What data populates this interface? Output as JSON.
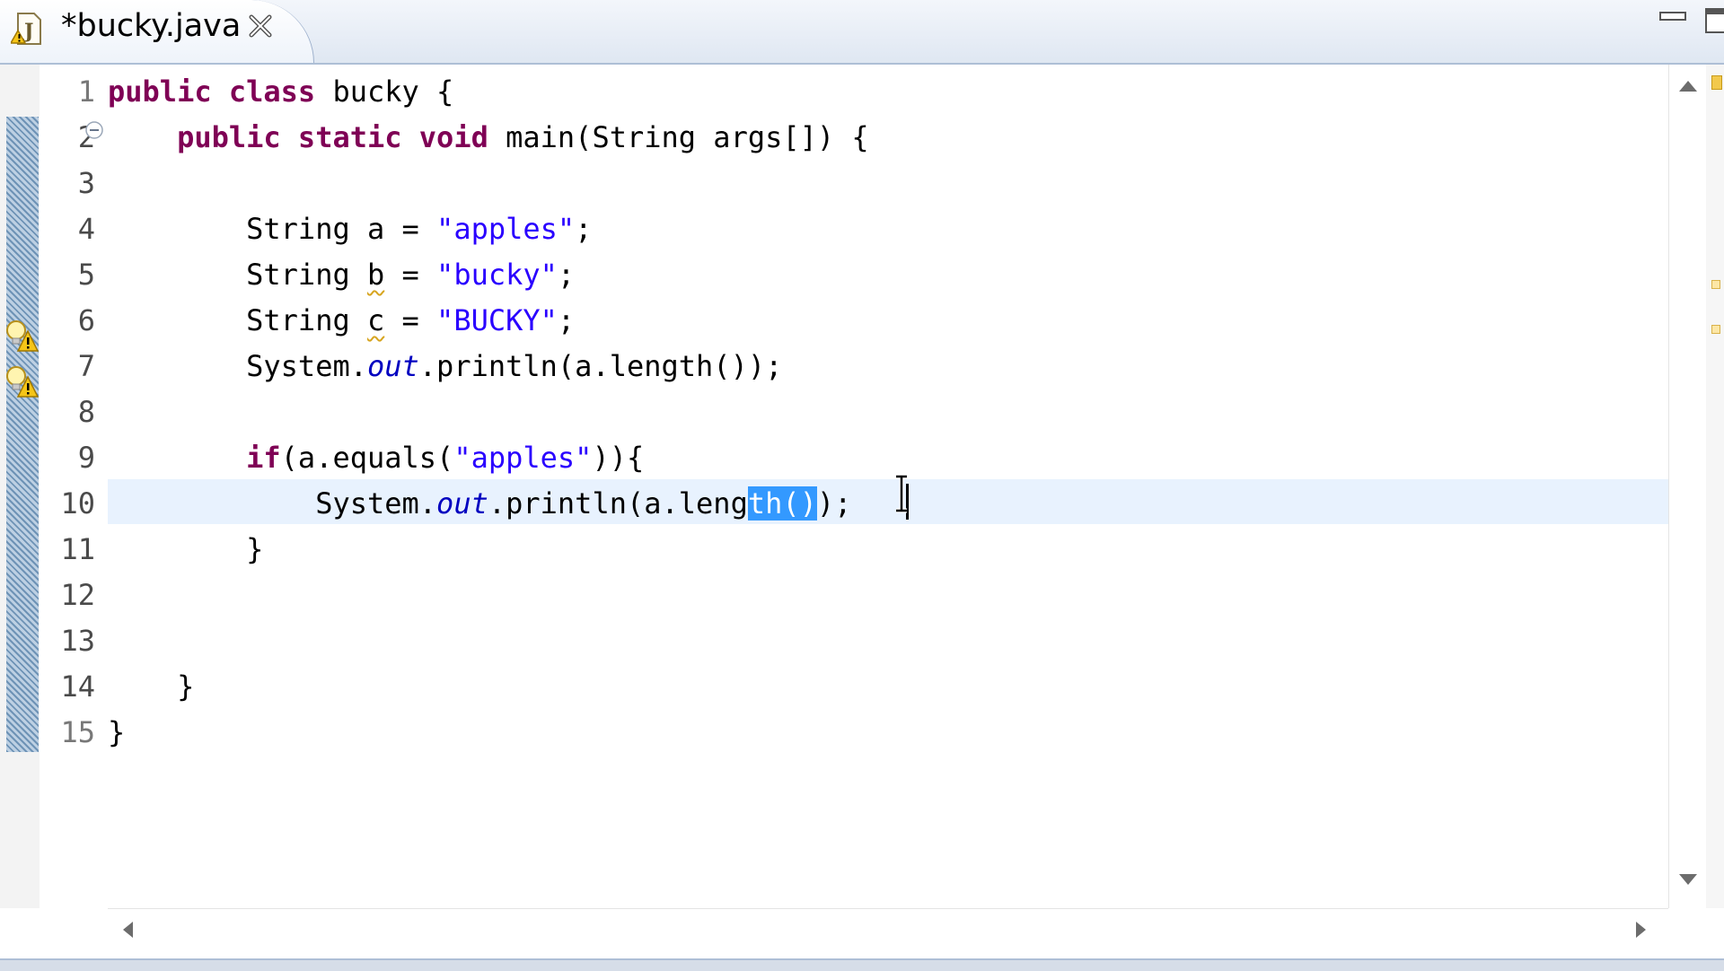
{
  "tab": {
    "title": "*bucky.java",
    "file_icon": "java-file-warning-icon",
    "close_icon": "close-icon"
  },
  "window_controls": {
    "minimize_icon": "minimize-icon",
    "maximize_icon": "maximize-icon"
  },
  "editor": {
    "line_numbers": [
      "1",
      "2",
      "3",
      "4",
      "5",
      "6",
      "7",
      "8",
      "9",
      "10",
      "11",
      "12",
      "13",
      "14",
      "15"
    ],
    "changed_lines": [
      2,
      3,
      4,
      5,
      6,
      7,
      8,
      9,
      10,
      11,
      12,
      13,
      14
    ],
    "warning_lines": [
      5,
      6
    ],
    "fold_line": 2,
    "current_line": 10,
    "lines": [
      [
        {
          "t": "public",
          "c": "kw"
        },
        {
          "t": " "
        },
        {
          "t": "class",
          "c": "kw"
        },
        {
          "t": " bucky {"
        }
      ],
      [
        {
          "t": "    "
        },
        {
          "t": "public",
          "c": "kw"
        },
        {
          "t": " "
        },
        {
          "t": "static",
          "c": "kw"
        },
        {
          "t": " "
        },
        {
          "t": "void",
          "c": "kw"
        },
        {
          "t": " main(String args[]) {"
        }
      ],
      [],
      [
        {
          "t": "        String a = "
        },
        {
          "t": "\"apples\"",
          "c": "str"
        },
        {
          "t": ";"
        }
      ],
      [
        {
          "t": "        String "
        },
        {
          "t": "b",
          "c": "squig"
        },
        {
          "t": " = "
        },
        {
          "t": "\"bucky\"",
          "c": "str"
        },
        {
          "t": ";"
        }
      ],
      [
        {
          "t": "        String "
        },
        {
          "t": "c",
          "c": "squig"
        },
        {
          "t": " = "
        },
        {
          "t": "\"BUCKY\"",
          "c": "str"
        },
        {
          "t": ";"
        }
      ],
      [
        {
          "t": "        System."
        },
        {
          "t": "out",
          "c": "fld"
        },
        {
          "t": ".println(a.length());"
        }
      ],
      [],
      [
        {
          "t": "        "
        },
        {
          "t": "if",
          "c": "kw"
        },
        {
          "t": "(a.equals("
        },
        {
          "t": "\"apples\"",
          "c": "str"
        },
        {
          "t": ")){"
        }
      ],
      [
        {
          "t": "            System."
        },
        {
          "t": "out",
          "c": "fld"
        },
        {
          "t": ".println(a.leng"
        },
        {
          "t": "th()",
          "c": "sel"
        },
        {
          "t": ");"
        }
      ],
      [
        {
          "t": "        }"
        }
      ],
      [],
      [],
      [
        {
          "t": "    }"
        }
      ],
      [
        {
          "t": "}"
        }
      ]
    ]
  },
  "scrollbars": {
    "up_icon": "scroll-up-arrow-icon",
    "down_icon": "scroll-down-arrow-icon",
    "left_icon": "scroll-left-arrow-icon",
    "right_icon": "scroll-right-arrow-icon"
  },
  "colors": {
    "keyword": "#7f0055",
    "string": "#2a00ff",
    "field": "#0000c0",
    "selection": "#3399ff",
    "current_line": "#e8f2fe"
  }
}
